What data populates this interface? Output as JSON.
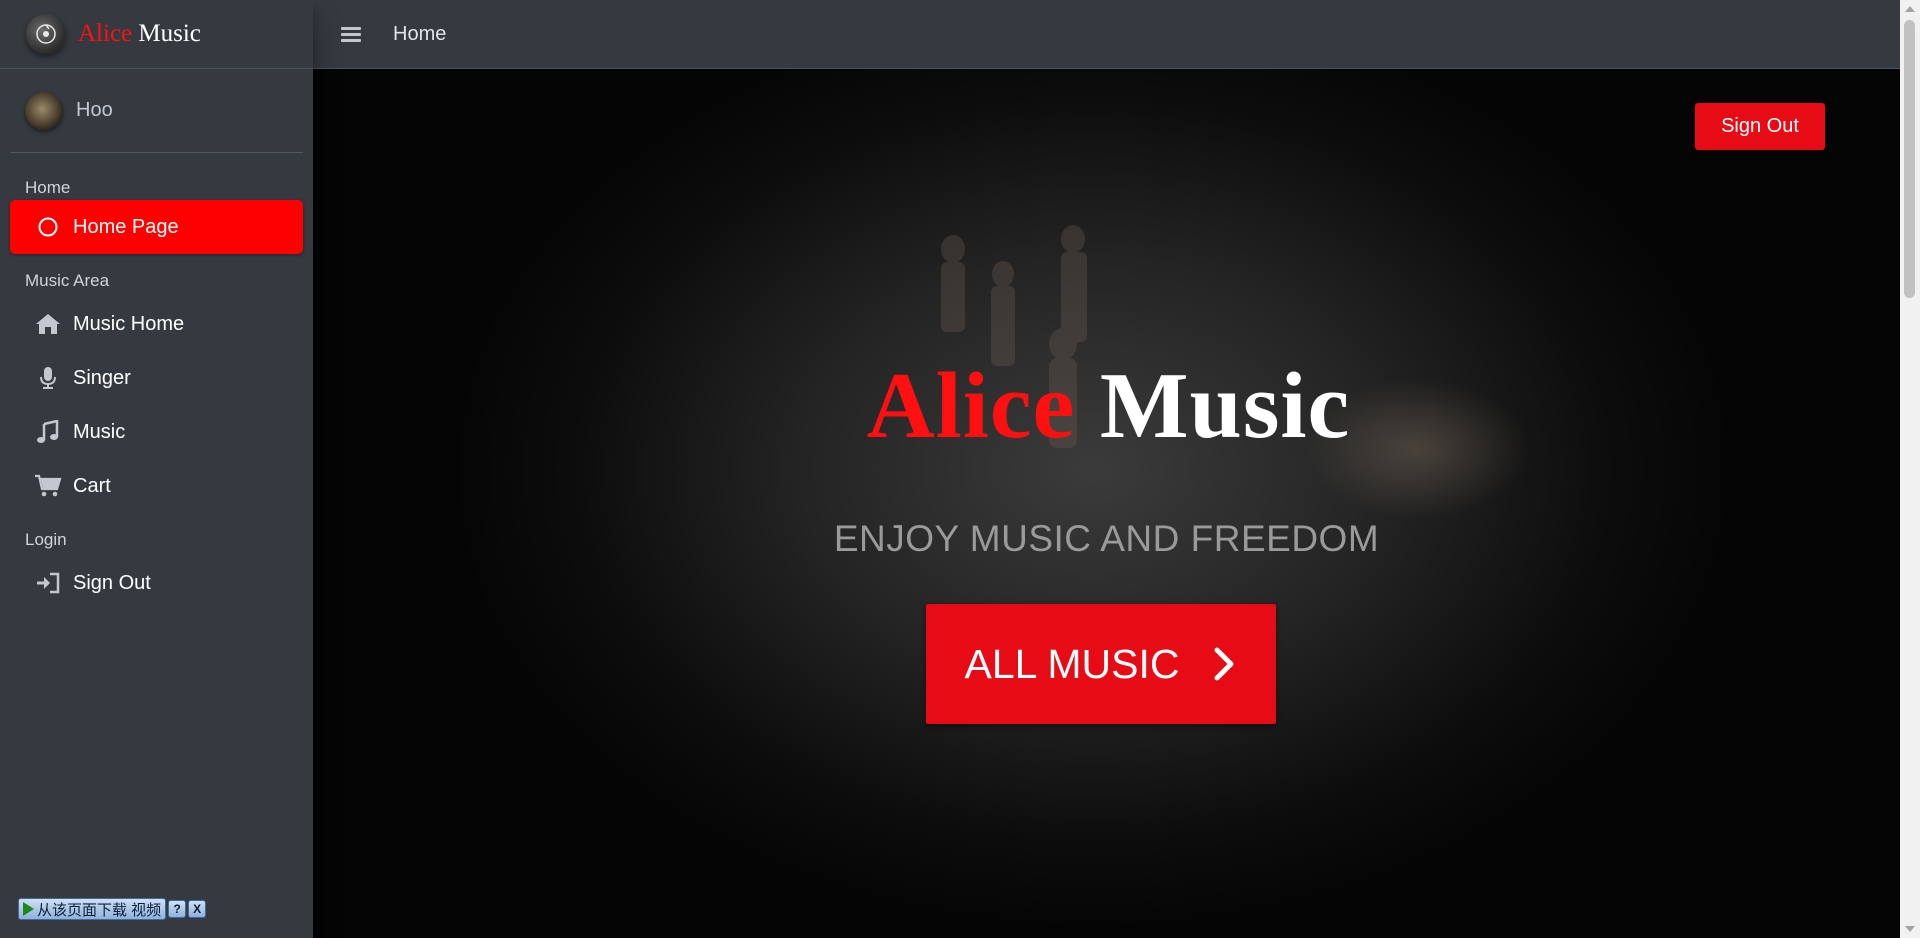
{
  "brand": {
    "name_red": "Alice",
    "name_white": "Music",
    "logo_icon": "record-disc-icon"
  },
  "user": {
    "name": "Hoo"
  },
  "topbar": {
    "menu_icon": "hamburger-icon",
    "title": "Home"
  },
  "sidebar": {
    "sections": [
      {
        "header": "Home",
        "items": [
          {
            "label": "Home Page",
            "icon": "circle-icon",
            "active": true
          }
        ]
      },
      {
        "header": "Music Area",
        "items": [
          {
            "label": "Music Home",
            "icon": "house-icon"
          },
          {
            "label": "Singer",
            "icon": "microphone-icon"
          },
          {
            "label": "Music",
            "icon": "music-note-icon"
          },
          {
            "label": "Cart",
            "icon": "cart-icon"
          }
        ]
      },
      {
        "header": "Login",
        "items": [
          {
            "label": "Sign Out",
            "icon": "sign-in-icon"
          }
        ]
      }
    ]
  },
  "hero": {
    "signout_label": "Sign Out",
    "title_red": "Alice",
    "title_white": "Music",
    "subtitle": "ENJOY MUSIC AND FREEDOM",
    "cta_label": "ALL MUSIC"
  },
  "download_bar": {
    "label": "从该页面下载 视频",
    "help": "?",
    "close": "X"
  },
  "colors": {
    "accent_red": "#e60b14",
    "active_red": "#ff0000",
    "sidebar_bg": "#343a40"
  }
}
